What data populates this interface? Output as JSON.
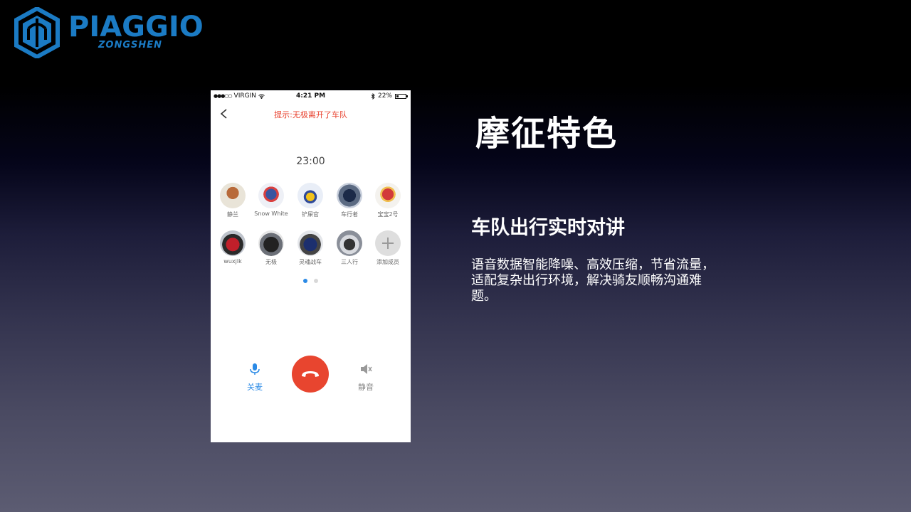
{
  "logo": {
    "brand": "PIAGGIO",
    "sub": "ZONGSHEN",
    "color": "#1b7bc4"
  },
  "phone": {
    "status": {
      "carrier": "VIRGIN",
      "time": "4:21 PM",
      "battery": "22%"
    },
    "hint": "提示:无极离开了车队",
    "timer": "23:00",
    "members": [
      {
        "name": "静兰"
      },
      {
        "name": "Snow White"
      },
      {
        "name": "铲屎官"
      },
      {
        "name": "车行者"
      },
      {
        "name": "宝宝2号"
      },
      {
        "name": "wuxjlk"
      },
      {
        "name": "无极"
      },
      {
        "name": "灵魂战车"
      },
      {
        "name": "三人行"
      },
      {
        "name": "添加成员"
      }
    ],
    "controls": {
      "mic_label": "关麦",
      "mute_label": "静音"
    },
    "accent": "#2a8ae6",
    "hangup_color": "#e8452f"
  },
  "panel": {
    "title": "摩征特色",
    "section_title": "车队出行实时对讲",
    "section_body": "语音数据智能降噪、高效压缩，节省流量，适配复杂出行环境，解决骑友顺畅沟通难题。"
  }
}
